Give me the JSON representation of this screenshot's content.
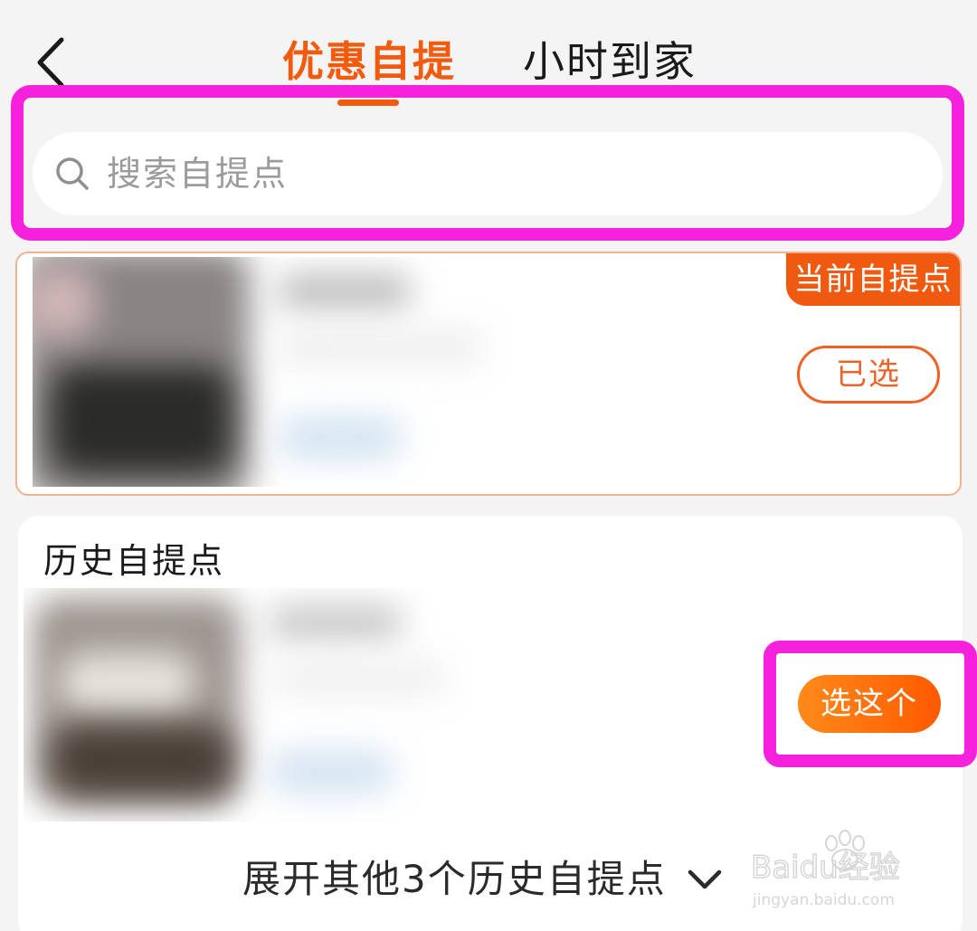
{
  "header": {
    "tabs": [
      {
        "label": "优惠自提",
        "active": true
      },
      {
        "label": "小时到家",
        "active": false
      }
    ]
  },
  "search": {
    "placeholder": "搜索自提点"
  },
  "current_pickup": {
    "badge": "当前自提点",
    "button_label": "已选"
  },
  "history": {
    "title": "历史自提点",
    "select_button_label": "选这个",
    "expand_label": "展开其他3个历史自提点"
  },
  "icons": {
    "back": "chevron-left-icon",
    "search": "search-icon",
    "expand": "chevron-down-icon"
  },
  "colors": {
    "accent": "#f25a0d",
    "highlight": "#f521dd"
  },
  "watermark": {
    "brand": "Baidu经验",
    "url": "jingyan.baidu.com"
  }
}
